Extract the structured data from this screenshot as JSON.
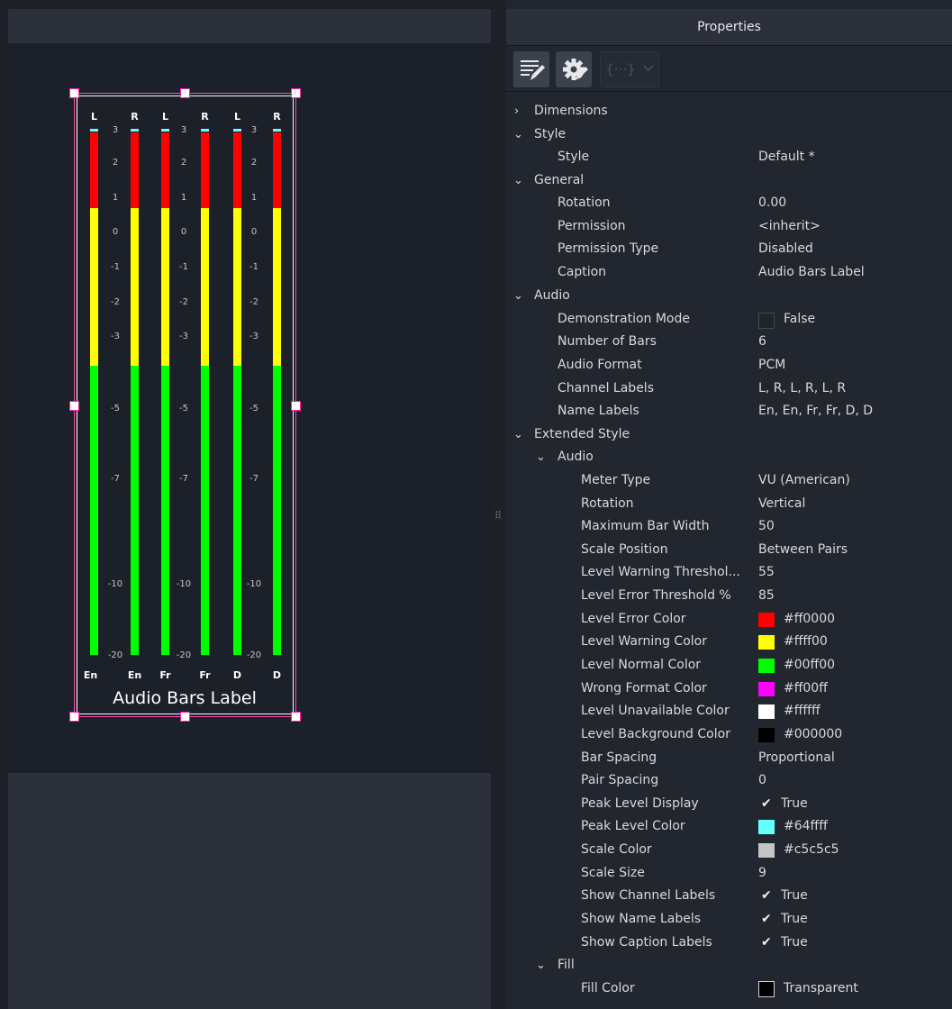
{
  "window": {
    "panel_title": "Properties"
  },
  "toolbar": {
    "buttons": [
      {
        "icon": "edit-properties-icon"
      },
      {
        "icon": "gear-icon"
      },
      {
        "icon": "script-braces-icon"
      },
      {
        "icon": "chevron-down-icon"
      }
    ]
  },
  "meter": {
    "channel_labels": [
      "L",
      "R",
      "L",
      "R",
      "L",
      "R"
    ],
    "name_labels": [
      "En",
      "En",
      "Fr",
      "Fr",
      "D",
      "D"
    ],
    "caption": "Audio Bars Label",
    "scale_ticks": [
      "3",
      "2",
      "1",
      "0",
      "-1",
      "-2",
      "-3",
      "-5",
      "-7",
      "-10",
      "-20"
    ],
    "colors": {
      "error": "#ff0000",
      "warning": "#ffff00",
      "normal": "#00ff00",
      "peak": "#64ffff",
      "scale": "#c5c5c5",
      "selection": "#ff4aa8"
    }
  },
  "properties": {
    "dimensions": {
      "label": "Dimensions"
    },
    "style_section": {
      "label": "Style",
      "style": {
        "label": "Style",
        "value": "Default *"
      }
    },
    "general": {
      "label": "General",
      "rotation": {
        "label": "Rotation",
        "value": "0.00"
      },
      "permission": {
        "label": "Permission",
        "value": "<inherit>"
      },
      "permission_type": {
        "label": "Permission Type",
        "value": "Disabled"
      },
      "caption": {
        "label": "Caption",
        "value": "Audio Bars Label"
      }
    },
    "audio": {
      "label": "Audio",
      "demo_mode": {
        "label": "Demonstration Mode",
        "value": "False"
      },
      "number_of_bars": {
        "label": "Number of Bars",
        "value": "6"
      },
      "audio_format": {
        "label": "Audio Format",
        "value": "PCM"
      },
      "channel_labels": {
        "label": "Channel Labels",
        "value": "L, R, L, R, L, R"
      },
      "name_labels": {
        "label": "Name Labels",
        "value": "En, En, Fr, Fr, D, D"
      }
    },
    "extended_style": {
      "label": "Extended Style",
      "audio": {
        "label": "Audio",
        "meter_type": {
          "label": "Meter Type",
          "value": "VU (American)"
        },
        "rotation": {
          "label": "Rotation",
          "value": "Vertical"
        },
        "max_bar_width": {
          "label": "Maximum Bar Width",
          "value": "50"
        },
        "scale_position": {
          "label": "Scale Position",
          "value": "Between Pairs"
        },
        "level_warning_threshold": {
          "label": "Level Warning Threshol...",
          "value": "55"
        },
        "level_error_threshold": {
          "label": "Level Error Threshold %",
          "value": "85"
        },
        "level_error_color": {
          "label": "Level Error Color",
          "value": "#ff0000",
          "swatch": "#ff0000"
        },
        "level_warning_color": {
          "label": "Level Warning Color",
          "value": "#ffff00",
          "swatch": "#ffff00"
        },
        "level_normal_color": {
          "label": "Level Normal Color",
          "value": "#00ff00",
          "swatch": "#00ff00"
        },
        "wrong_format_color": {
          "label": "Wrong Format Color",
          "value": "#ff00ff",
          "swatch": "#ff00ff"
        },
        "level_unavailable_color": {
          "label": "Level Unavailable Color",
          "value": "#ffffff",
          "swatch": "#ffffff"
        },
        "level_background_color": {
          "label": "Level Background Color",
          "value": "#000000",
          "swatch": "#000000"
        },
        "bar_spacing": {
          "label": "Bar Spacing",
          "value": "Proportional"
        },
        "pair_spacing": {
          "label": "Pair Spacing",
          "value": "0"
        },
        "peak_level_display": {
          "label": "Peak Level Display",
          "value": "True"
        },
        "peak_level_color": {
          "label": "Peak Level Color",
          "value": "#64ffff",
          "swatch": "#64ffff"
        },
        "scale_color": {
          "label": "Scale Color",
          "value": "#c5c5c5",
          "swatch": "#c5c5c5"
        },
        "scale_size": {
          "label": "Scale Size",
          "value": "9"
        },
        "show_channel_labels": {
          "label": "Show Channel Labels",
          "value": "True"
        },
        "show_name_labels": {
          "label": "Show Name Labels",
          "value": "True"
        },
        "show_caption_labels": {
          "label": "Show Caption Labels",
          "value": "True"
        }
      },
      "fill": {
        "label": "Fill",
        "fill_color": {
          "label": "Fill Color",
          "value": "Transparent"
        }
      }
    }
  }
}
